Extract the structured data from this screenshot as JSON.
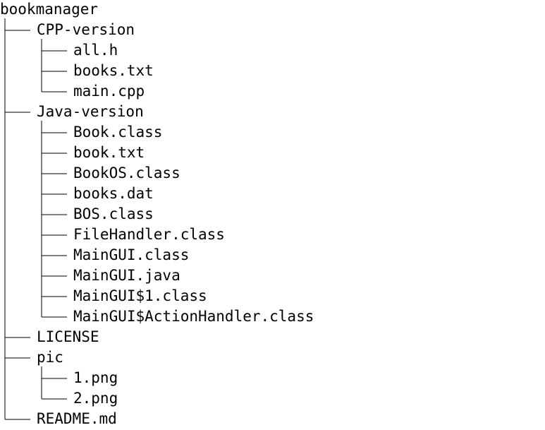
{
  "root": {
    "label": "bookmanager"
  },
  "children": [
    {
      "label": "CPP-version",
      "icon": "folder-icon",
      "children": [
        {
          "label": "all.h"
        },
        {
          "label": "books.txt"
        },
        {
          "label": "main.cpp"
        }
      ]
    },
    {
      "label": "Java-version",
      "icon": "folder-icon",
      "children": [
        {
          "label": "Book.class"
        },
        {
          "label": "book.txt"
        },
        {
          "label": "BookOS.class"
        },
        {
          "label": "books.dat"
        },
        {
          "label": "BOS.class"
        },
        {
          "label": "FileHandler.class"
        },
        {
          "label": "MainGUI.class"
        },
        {
          "label": "MainGUI.java"
        },
        {
          "label": "MainGUI$1.class"
        },
        {
          "label": "MainGUI$ActionHandler.class"
        }
      ]
    },
    {
      "label": "LICENSE"
    },
    {
      "label": "pic",
      "icon": "folder-icon",
      "children": [
        {
          "label": "1.png"
        },
        {
          "label": "2.png"
        }
      ]
    },
    {
      "label": "README.md"
    }
  ],
  "colors": {
    "text": "#000000",
    "line": "#000000",
    "background": "#ffffff"
  }
}
